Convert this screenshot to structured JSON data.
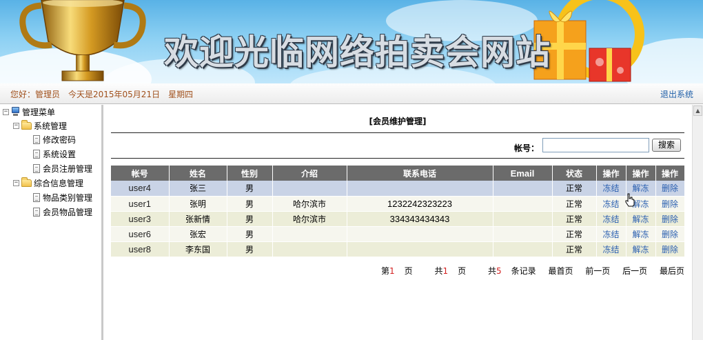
{
  "banner": {
    "title": "欢迎光临网络拍卖会网站"
  },
  "topbar": {
    "greeting": "您好：管理员　今天是2015年05月21日　星期四",
    "logout": "退出系统"
  },
  "sidebar": {
    "root": "管理菜单",
    "groups": [
      {
        "label": "系统管理",
        "items": [
          "修改密码",
          "系统设置",
          "会员注册管理"
        ]
      },
      {
        "label": "综合信息管理",
        "items": [
          "物品类别管理",
          "会员物品管理"
        ]
      }
    ]
  },
  "main": {
    "title": "[会员维护管理]",
    "search_label": "帐号：",
    "search_value": "",
    "search_button": "搜索"
  },
  "table": {
    "headers": [
      "帐号",
      "姓名",
      "性别",
      "介绍",
      "联系电话",
      "Email",
      "状态",
      "操作",
      "操作",
      "操作"
    ],
    "rows": [
      {
        "account": "user4",
        "name": "张三",
        "gender": "男",
        "intro": "",
        "phone": "",
        "email": "",
        "status": "正常",
        "freeze": "冻结",
        "unfreeze": "解冻",
        "delete": "删除"
      },
      {
        "account": "user1",
        "name": "张明",
        "gender": "男",
        "intro": "哈尔滨市",
        "phone": "1232242323223",
        "email": "",
        "status": "正常",
        "freeze": "冻结",
        "unfreeze": "解冻",
        "delete": "删除"
      },
      {
        "account": "user3",
        "name": "张新情",
        "gender": "男",
        "intro": "哈尔滨市",
        "phone": "334343434343",
        "email": "",
        "status": "正常",
        "freeze": "冻结",
        "unfreeze": "解冻",
        "delete": "删除"
      },
      {
        "account": "user6",
        "name": "张宏",
        "gender": "男",
        "intro": "",
        "phone": "",
        "email": "",
        "status": "正常",
        "freeze": "冻结",
        "unfreeze": "解冻",
        "delete": "删除"
      },
      {
        "account": "user8",
        "name": "李东国",
        "gender": "男",
        "intro": "",
        "phone": "",
        "email": "",
        "status": "正常",
        "freeze": "冻结",
        "unfreeze": "解冻",
        "delete": "删除"
      }
    ]
  },
  "pager": {
    "page_prefix": "第",
    "page_num": "1",
    "page_suffix": "页",
    "total_prefix": "共",
    "total_num": "1",
    "total_suffix": "页",
    "records_prefix": "共",
    "records_num": "5",
    "records_suffix": "条记录",
    "first": "最首页",
    "prev": "前一页",
    "next": "后一页",
    "last": "最后页"
  },
  "colors": {
    "header_bg": "#6b6b6b",
    "row_selected": "#c9d3e6",
    "row_odd": "#f6f6ee",
    "row_even": "#ecedd8",
    "link": "#2a5fb0",
    "greeting": "#a0501c",
    "pager_number": "#d32020"
  }
}
